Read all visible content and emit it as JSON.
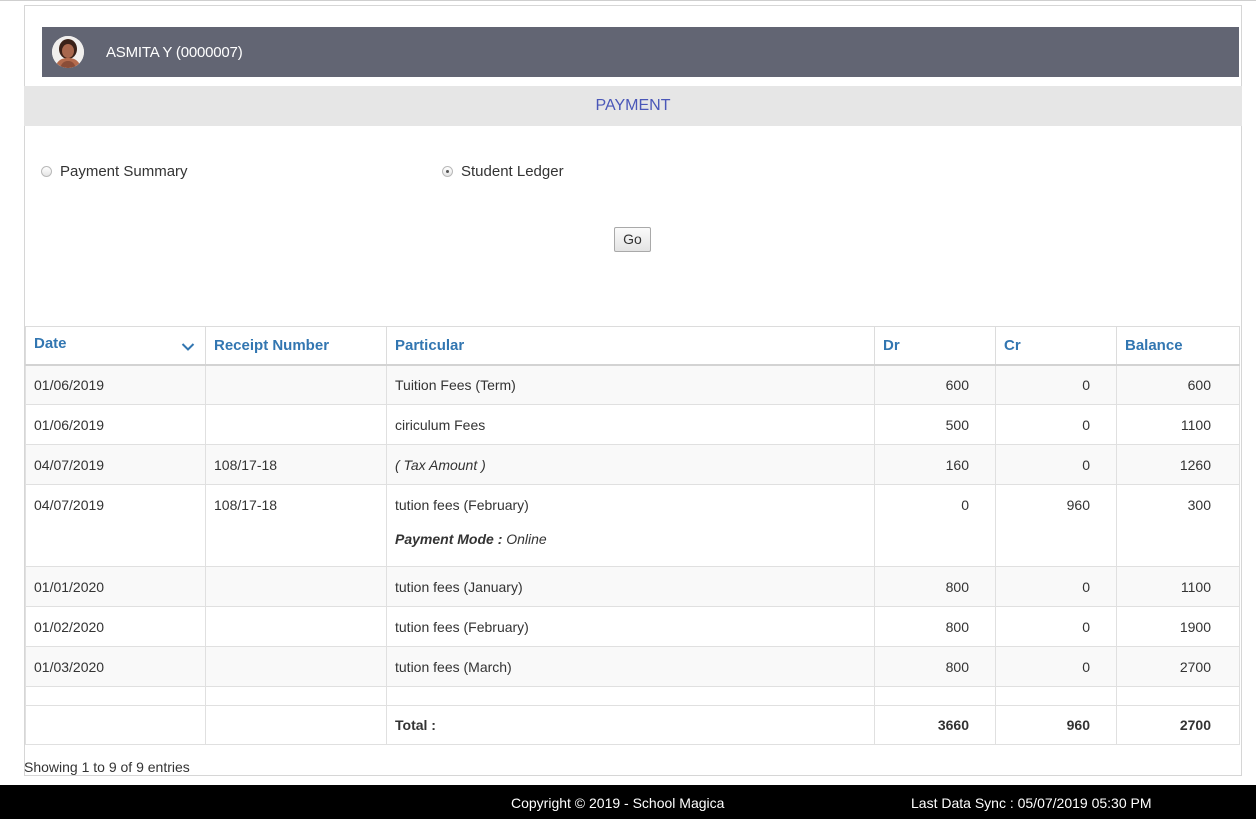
{
  "student": {
    "name": "ASMITA Y (0000007)"
  },
  "section": {
    "title": "PAYMENT"
  },
  "options": [
    {
      "label": "Payment Summary",
      "checked": false
    },
    {
      "label": "Student Ledger",
      "checked": true
    }
  ],
  "go_label": "Go",
  "table": {
    "headers": [
      "Date",
      "Receipt Number",
      "Particular",
      "Dr",
      "Cr",
      "Balance"
    ],
    "rows": [
      {
        "date": "01/06/2019",
        "receipt": "",
        "particular": "Tuition Fees (Term)",
        "dr": "600",
        "cr": "0",
        "balance": "600"
      },
      {
        "date": "01/06/2019",
        "receipt": "",
        "particular": "ciriculum Fees",
        "dr": "500",
        "cr": "0",
        "balance": "1100"
      },
      {
        "date": "04/07/2019",
        "receipt": "108/17-18",
        "particular": "( Tax Amount )",
        "dr": "160",
        "cr": "0",
        "balance": "1260"
      },
      {
        "date": "04/07/2019",
        "receipt": "108/17-18",
        "particular": "tution fees (February)",
        "payment_mode_label": "Payment Mode :",
        "payment_mode": "Online",
        "dr": "0",
        "cr": "960",
        "balance": "300"
      },
      {
        "date": "01/01/2020",
        "receipt": "",
        "particular": "tution fees (January)",
        "dr": "800",
        "cr": "0",
        "balance": "1100"
      },
      {
        "date": "01/02/2020",
        "receipt": "",
        "particular": "tution fees (February)",
        "dr": "800",
        "cr": "0",
        "balance": "1900"
      },
      {
        "date": "01/03/2020",
        "receipt": "",
        "particular": "tution fees (March)",
        "dr": "800",
        "cr": "0",
        "balance": "2700"
      }
    ],
    "total": {
      "label": "Total :",
      "dr": "3660",
      "cr": "960",
      "balance": "2700"
    }
  },
  "showing_text": "Showing 1 to 9 of 9 entries",
  "footer": {
    "copyright": "Copyright © 2019 - School Magica",
    "sync": "Last Data Sync : 05/07/2019 05:30 PM"
  },
  "icons": {
    "sort": "chevron-down-icon",
    "avatar": "student-photo"
  },
  "colors": {
    "header_bar": "#626573",
    "accent_blue": "#3276b1",
    "section_title": "#4a57b8",
    "footer": "#000000"
  }
}
